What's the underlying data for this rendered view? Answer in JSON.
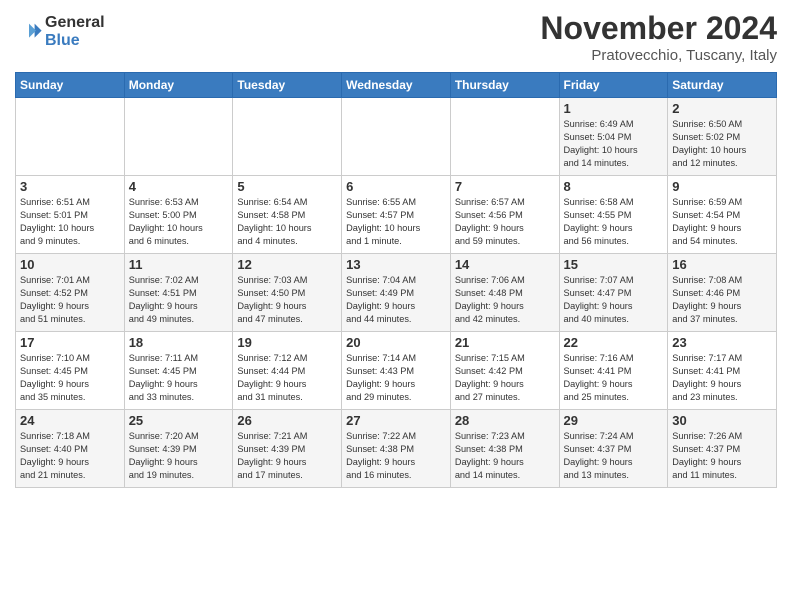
{
  "header": {
    "logo_text_general": "General",
    "logo_text_blue": "Blue",
    "month": "November 2024",
    "location": "Pratovecchio, Tuscany, Italy"
  },
  "weekdays": [
    "Sunday",
    "Monday",
    "Tuesday",
    "Wednesday",
    "Thursday",
    "Friday",
    "Saturday"
  ],
  "weeks": [
    [
      {
        "day": "",
        "info": ""
      },
      {
        "day": "",
        "info": ""
      },
      {
        "day": "",
        "info": ""
      },
      {
        "day": "",
        "info": ""
      },
      {
        "day": "",
        "info": ""
      },
      {
        "day": "1",
        "info": "Sunrise: 6:49 AM\nSunset: 5:04 PM\nDaylight: 10 hours\nand 14 minutes."
      },
      {
        "day": "2",
        "info": "Sunrise: 6:50 AM\nSunset: 5:02 PM\nDaylight: 10 hours\nand 12 minutes."
      }
    ],
    [
      {
        "day": "3",
        "info": "Sunrise: 6:51 AM\nSunset: 5:01 PM\nDaylight: 10 hours\nand 9 minutes."
      },
      {
        "day": "4",
        "info": "Sunrise: 6:53 AM\nSunset: 5:00 PM\nDaylight: 10 hours\nand 6 minutes."
      },
      {
        "day": "5",
        "info": "Sunrise: 6:54 AM\nSunset: 4:58 PM\nDaylight: 10 hours\nand 4 minutes."
      },
      {
        "day": "6",
        "info": "Sunrise: 6:55 AM\nSunset: 4:57 PM\nDaylight: 10 hours\nand 1 minute."
      },
      {
        "day": "7",
        "info": "Sunrise: 6:57 AM\nSunset: 4:56 PM\nDaylight: 9 hours\nand 59 minutes."
      },
      {
        "day": "8",
        "info": "Sunrise: 6:58 AM\nSunset: 4:55 PM\nDaylight: 9 hours\nand 56 minutes."
      },
      {
        "day": "9",
        "info": "Sunrise: 6:59 AM\nSunset: 4:54 PM\nDaylight: 9 hours\nand 54 minutes."
      }
    ],
    [
      {
        "day": "10",
        "info": "Sunrise: 7:01 AM\nSunset: 4:52 PM\nDaylight: 9 hours\nand 51 minutes."
      },
      {
        "day": "11",
        "info": "Sunrise: 7:02 AM\nSunset: 4:51 PM\nDaylight: 9 hours\nand 49 minutes."
      },
      {
        "day": "12",
        "info": "Sunrise: 7:03 AM\nSunset: 4:50 PM\nDaylight: 9 hours\nand 47 minutes."
      },
      {
        "day": "13",
        "info": "Sunrise: 7:04 AM\nSunset: 4:49 PM\nDaylight: 9 hours\nand 44 minutes."
      },
      {
        "day": "14",
        "info": "Sunrise: 7:06 AM\nSunset: 4:48 PM\nDaylight: 9 hours\nand 42 minutes."
      },
      {
        "day": "15",
        "info": "Sunrise: 7:07 AM\nSunset: 4:47 PM\nDaylight: 9 hours\nand 40 minutes."
      },
      {
        "day": "16",
        "info": "Sunrise: 7:08 AM\nSunset: 4:46 PM\nDaylight: 9 hours\nand 37 minutes."
      }
    ],
    [
      {
        "day": "17",
        "info": "Sunrise: 7:10 AM\nSunset: 4:45 PM\nDaylight: 9 hours\nand 35 minutes."
      },
      {
        "day": "18",
        "info": "Sunrise: 7:11 AM\nSunset: 4:45 PM\nDaylight: 9 hours\nand 33 minutes."
      },
      {
        "day": "19",
        "info": "Sunrise: 7:12 AM\nSunset: 4:44 PM\nDaylight: 9 hours\nand 31 minutes."
      },
      {
        "day": "20",
        "info": "Sunrise: 7:14 AM\nSunset: 4:43 PM\nDaylight: 9 hours\nand 29 minutes."
      },
      {
        "day": "21",
        "info": "Sunrise: 7:15 AM\nSunset: 4:42 PM\nDaylight: 9 hours\nand 27 minutes."
      },
      {
        "day": "22",
        "info": "Sunrise: 7:16 AM\nSunset: 4:41 PM\nDaylight: 9 hours\nand 25 minutes."
      },
      {
        "day": "23",
        "info": "Sunrise: 7:17 AM\nSunset: 4:41 PM\nDaylight: 9 hours\nand 23 minutes."
      }
    ],
    [
      {
        "day": "24",
        "info": "Sunrise: 7:18 AM\nSunset: 4:40 PM\nDaylight: 9 hours\nand 21 minutes."
      },
      {
        "day": "25",
        "info": "Sunrise: 7:20 AM\nSunset: 4:39 PM\nDaylight: 9 hours\nand 19 minutes."
      },
      {
        "day": "26",
        "info": "Sunrise: 7:21 AM\nSunset: 4:39 PM\nDaylight: 9 hours\nand 17 minutes."
      },
      {
        "day": "27",
        "info": "Sunrise: 7:22 AM\nSunset: 4:38 PM\nDaylight: 9 hours\nand 16 minutes."
      },
      {
        "day": "28",
        "info": "Sunrise: 7:23 AM\nSunset: 4:38 PM\nDaylight: 9 hours\nand 14 minutes."
      },
      {
        "day": "29",
        "info": "Sunrise: 7:24 AM\nSunset: 4:37 PM\nDaylight: 9 hours\nand 13 minutes."
      },
      {
        "day": "30",
        "info": "Sunrise: 7:26 AM\nSunset: 4:37 PM\nDaylight: 9 hours\nand 11 minutes."
      }
    ]
  ]
}
